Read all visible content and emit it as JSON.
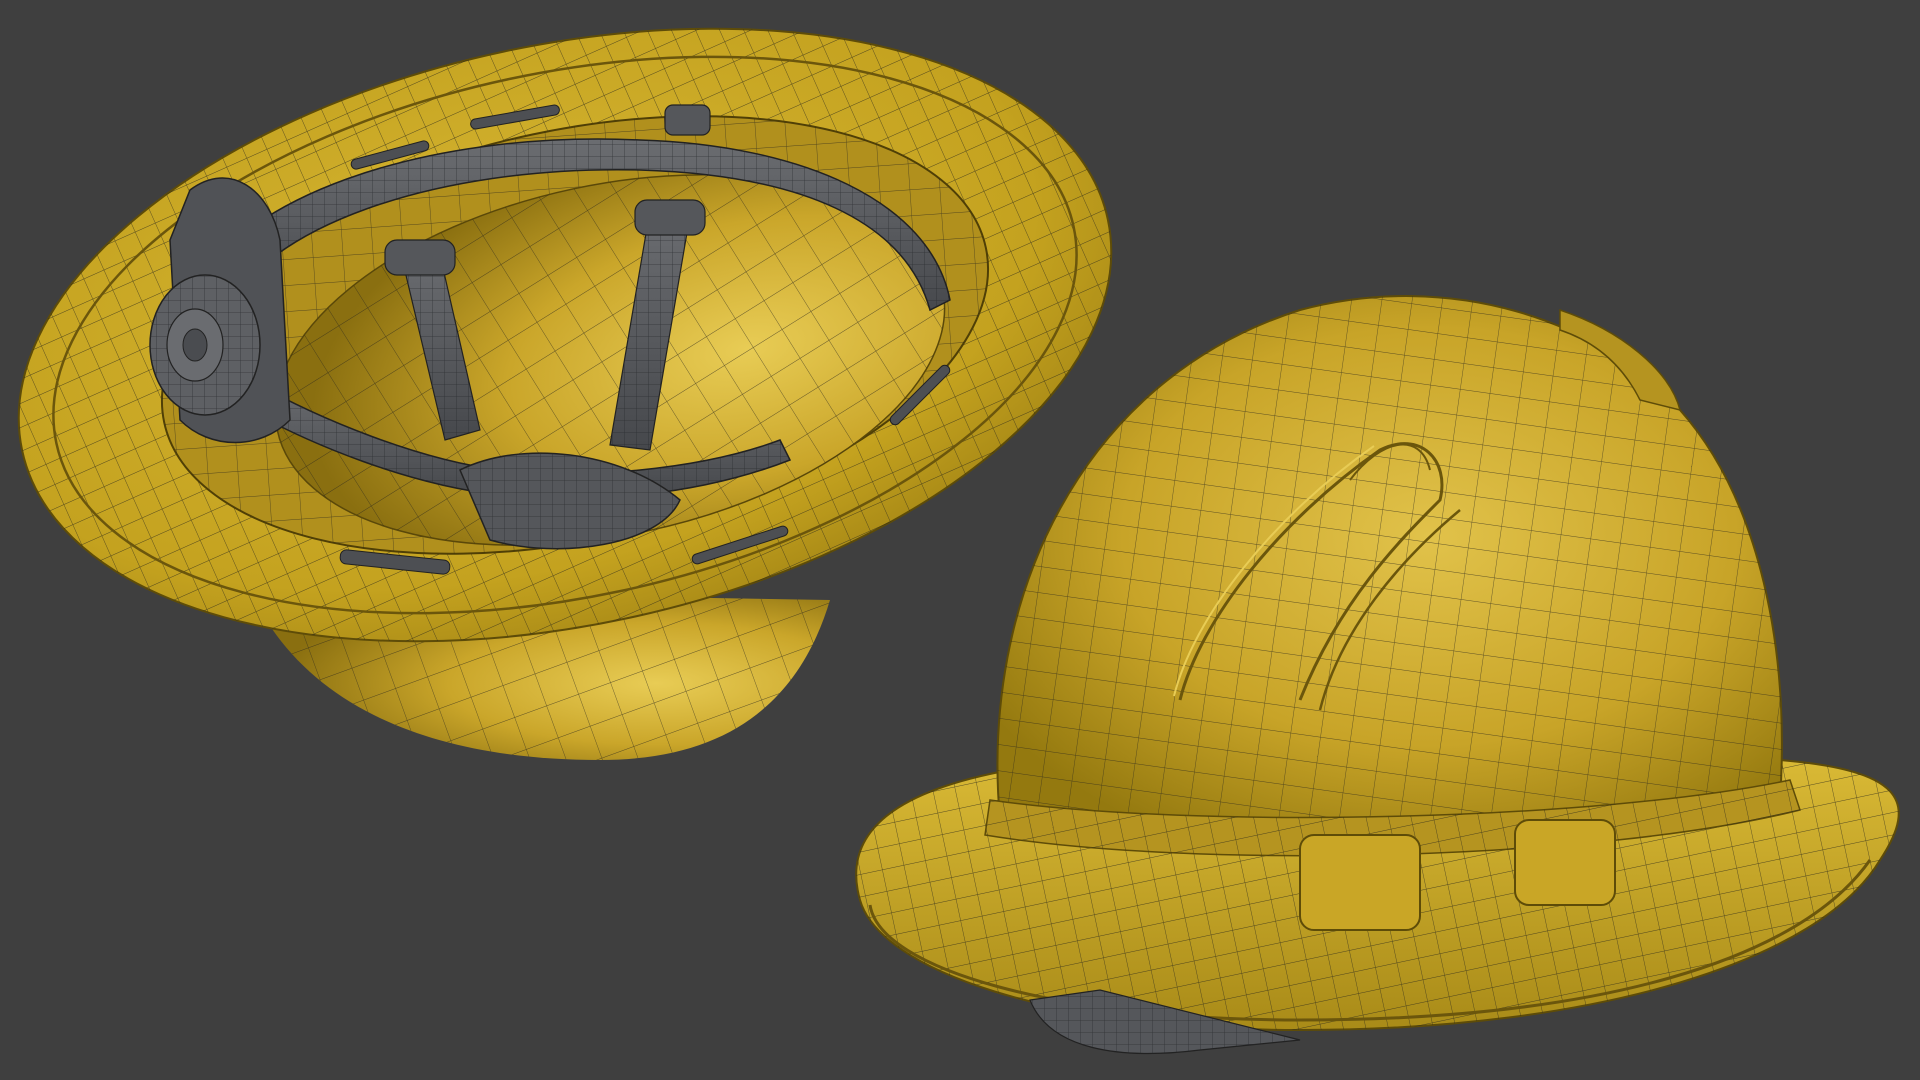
{
  "scene": {
    "background_color": "#3f3f3f",
    "shell_color": "#c9a626",
    "shell_highlight": "#e3c54a",
    "shell_shadow": "#8f7512",
    "wire_color": "#2d2a1c",
    "suspension_color": "#5d5f63",
    "suspension_shadow": "#3f4145",
    "objects": [
      {
        "name": "hard-hat-underside",
        "description_icon": "hard-hat-icon"
      },
      {
        "name": "hard-hat-side-view",
        "description_icon": "hard-hat-icon"
      }
    ]
  }
}
